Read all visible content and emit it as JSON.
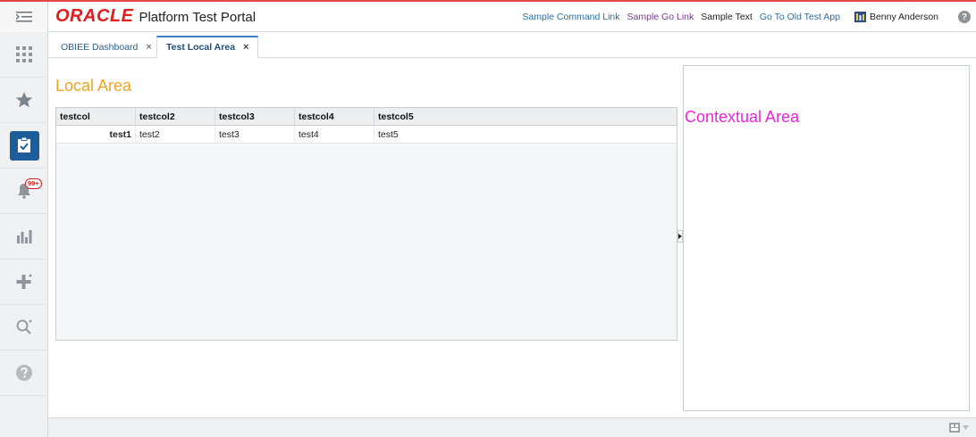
{
  "header": {
    "logo": "ORACLE",
    "title": "Platform Test Portal",
    "links": [
      {
        "label": "Sample Command Link"
      },
      {
        "label": "Sample Go Link"
      },
      {
        "label": "Sample Text"
      },
      {
        "label": "Go To Old Test App"
      }
    ],
    "user_name": "Benny Anderson",
    "help_glyph": "?"
  },
  "sidebar": {
    "items": [
      {
        "icon": "grid-icon"
      },
      {
        "icon": "star-icon"
      },
      {
        "icon": "task-checklist-icon",
        "active": true
      },
      {
        "icon": "bell-icon",
        "badge": "99+"
      },
      {
        "icon": "bar-chart-icon"
      },
      {
        "icon": "add-plus-icon"
      },
      {
        "icon": "search-icon"
      },
      {
        "icon": "help-icon"
      }
    ]
  },
  "tabs": [
    {
      "label": "OBIEE Dashboard",
      "active": false
    },
    {
      "label": "Test Local Area",
      "active": true
    }
  ],
  "tab_close_glyph": "×",
  "local_area": {
    "title": "Local Area",
    "columns": [
      "testcol",
      "testcol2",
      "testcol3",
      "testcol4",
      "testcol5"
    ],
    "rows": [
      [
        "test1",
        "test2",
        "test3",
        "test4",
        "test5"
      ]
    ]
  },
  "contextual_area": {
    "title": "Contextual Area"
  },
  "colors": {
    "oracle_red": "#e0201f",
    "local_title": "#f0a322",
    "contextual_title": "#ee22dd",
    "active_nav": "#1d5d99"
  }
}
